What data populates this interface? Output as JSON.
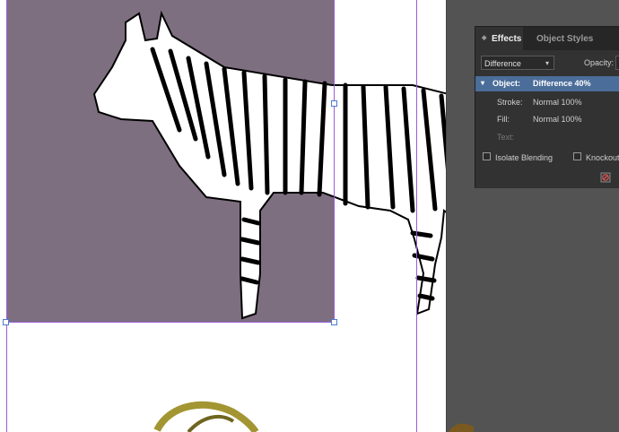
{
  "effects_panel": {
    "tabs": [
      {
        "label": "Effects",
        "active": true
      },
      {
        "label": "Object Styles",
        "active": false
      }
    ],
    "blend_mode": "Difference",
    "opacity_label": "Opacity:",
    "targets": [
      {
        "label": "Object:",
        "value": "Difference 40%",
        "selected": true
      },
      {
        "label": "Stroke:",
        "value": "Normal 100%"
      },
      {
        "label": "Fill:",
        "value": "Normal 100%"
      },
      {
        "label": "Text:",
        "value": ""
      }
    ],
    "isolate_blending_label": "Isolate Blending",
    "knockout_label": "Knockout",
    "icons": {
      "tab_grip": "double-arrow-grip-icon",
      "dropdown": "chevron-down-icon",
      "expand": "chevron-down-icon",
      "clear_effects": "clear-effects-icon"
    }
  },
  "document": {
    "frame_fill_color": "#7e6f80",
    "guide_color": "#9b5cd6",
    "selection_handle_color": "#4a7bd6"
  }
}
